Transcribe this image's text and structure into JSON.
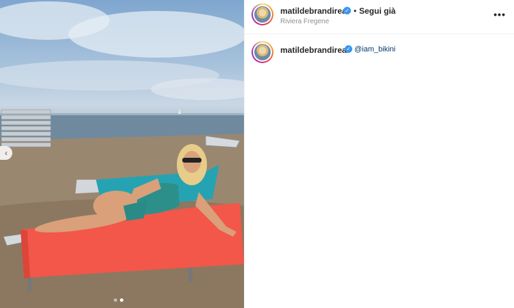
{
  "post": {
    "username": "matildebrandireal",
    "location": "Riviera Fregene",
    "follow_status": "Segui già",
    "separator": "•",
    "more_label": "•••",
    "verified_glyph": "✓",
    "caption_mention": "@iam_bikini",
    "carousel": {
      "count": 2,
      "active_index": 1
    },
    "prev_glyph": "‹"
  },
  "colors": {
    "verified": "#3897f0",
    "mention": "#00376b",
    "towel_red": "#f2574a",
    "towel_teal": "#26a3b2"
  },
  "icons": {
    "prev": "chevron-left-icon",
    "more": "more-horizontal-icon",
    "verified": "verified-badge-icon"
  }
}
